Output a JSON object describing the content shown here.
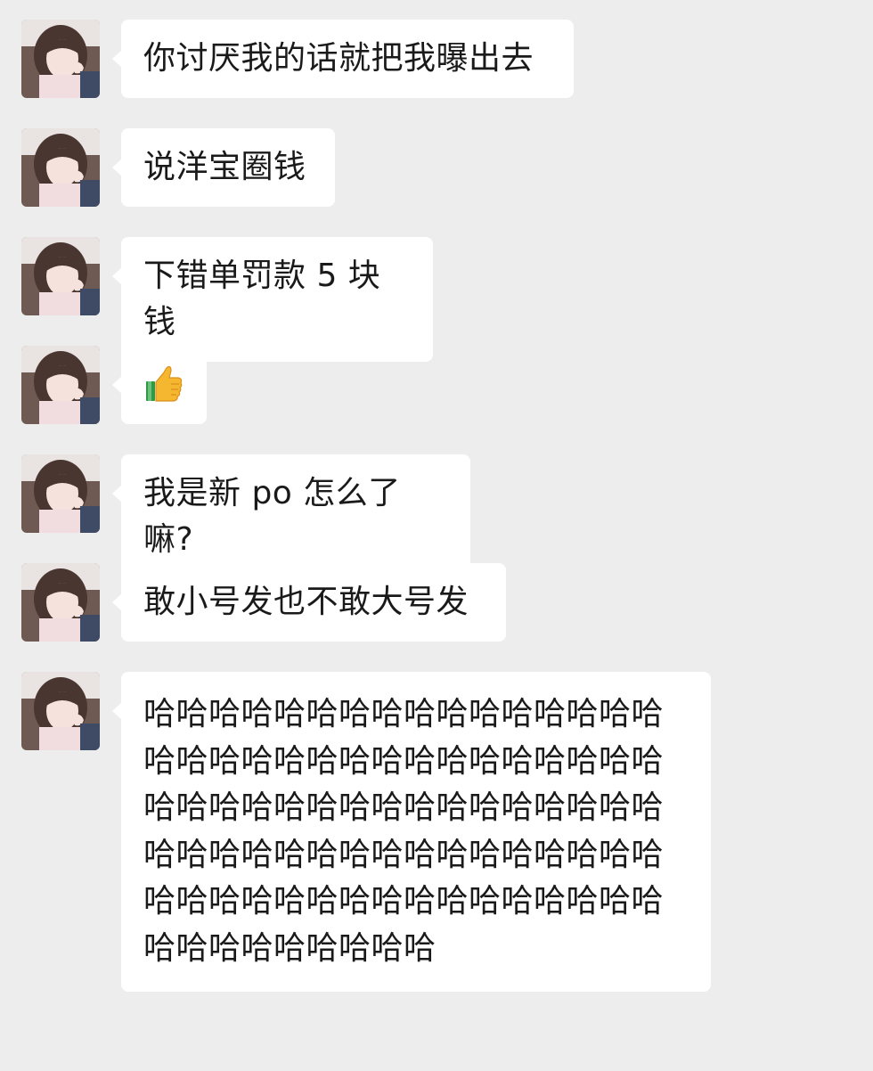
{
  "conversation": {
    "messages": [
      {
        "sender": "contact",
        "type": "text",
        "text": "你讨厌我的话就把我曝出去"
      },
      {
        "sender": "contact",
        "type": "text",
        "text": "说洋宝圈钱"
      },
      {
        "sender": "contact",
        "type": "text",
        "text": "下错单罚款 5 块钱"
      },
      {
        "sender": "contact",
        "type": "emoji",
        "icon": "thumbs-up-icon"
      },
      {
        "sender": "contact",
        "type": "text",
        "text": "我是新 po 怎么了嘛?"
      },
      {
        "sender": "contact",
        "type": "text",
        "text": "敢小号发也不敢大号发"
      },
      {
        "sender": "contact",
        "type": "text",
        "text": "哈哈哈哈哈哈哈哈哈哈哈哈哈哈哈哈哈哈哈哈哈哈哈哈哈哈哈哈哈哈哈哈哈哈哈哈哈哈哈哈哈哈哈哈哈哈哈哈哈哈哈哈哈哈哈哈哈哈哈哈哈哈哈哈哈哈哈哈哈哈哈哈哈哈哈哈哈哈哈哈哈哈哈哈哈哈哈哈哈"
      }
    ]
  },
  "colors": {
    "background": "#ededed",
    "bubble": "#ffffff",
    "text": "#1a1a1a"
  }
}
